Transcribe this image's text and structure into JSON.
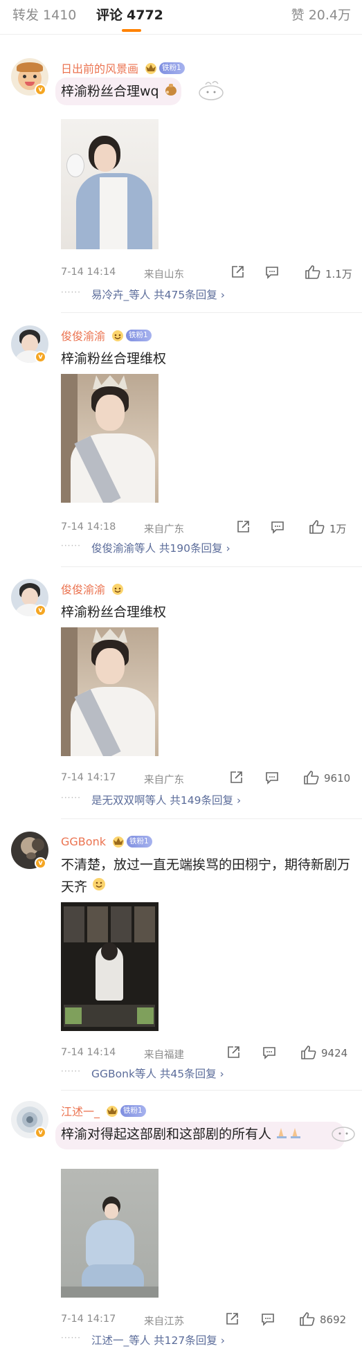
{
  "tabs": {
    "repost": {
      "label": "转发",
      "count": "1410"
    },
    "comment": {
      "label": "评论",
      "count": "4772"
    },
    "like": {
      "label": "赞",
      "count": "20.4万"
    }
  },
  "comments": [
    {
      "username": "日出前的风景画",
      "fan_badge": "铁粉1",
      "text": "梓渝粉丝合理wq",
      "time": "7-14 14:14",
      "location": "来自山东",
      "like_count": "1.1万",
      "replies_summary": "易冷卉_等人  共475条回复 ›"
    },
    {
      "username": "俊俊渝渝",
      "fan_badge": "铁粉1",
      "text": "梓渝粉丝合理维权",
      "time": "7-14 14:18",
      "location": "来自广东",
      "like_count": "1万",
      "replies_summary": "俊俊渝渝等人  共190条回复 ›"
    },
    {
      "username": "俊俊渝渝",
      "fan_badge": "",
      "text": "梓渝粉丝合理维权",
      "time": "7-14 14:17",
      "location": "来自广东",
      "like_count": "9610",
      "replies_summary": "是无双双啊等人  共149条回复 ›"
    },
    {
      "username": "GGBonk",
      "fan_badge": "铁粉1",
      "text": "不清楚，放过一直无端挨骂的田栩宁，期待新剧万天齐",
      "time": "7-14 14:14",
      "location": "来自福建",
      "like_count": "9424",
      "replies_summary": "GGBonk等人  共45条回复 ›"
    },
    {
      "username": "江述一_",
      "fan_badge": "铁粉1",
      "text": "梓渝对得起这部剧和这部剧的所有人",
      "time": "7-14 14:17",
      "location": "来自江苏",
      "like_count": "8692",
      "replies_summary": "江述一_等人  共127条回复 ›"
    }
  ],
  "colors": {
    "username": "#eb7350",
    "link": "#5b6c9a",
    "accent": "#ff8200",
    "fan_badge": "#8f9be6"
  },
  "icons": [
    "crown-icon",
    "verified-icon",
    "share-icon",
    "comment-icon",
    "like-icon"
  ]
}
